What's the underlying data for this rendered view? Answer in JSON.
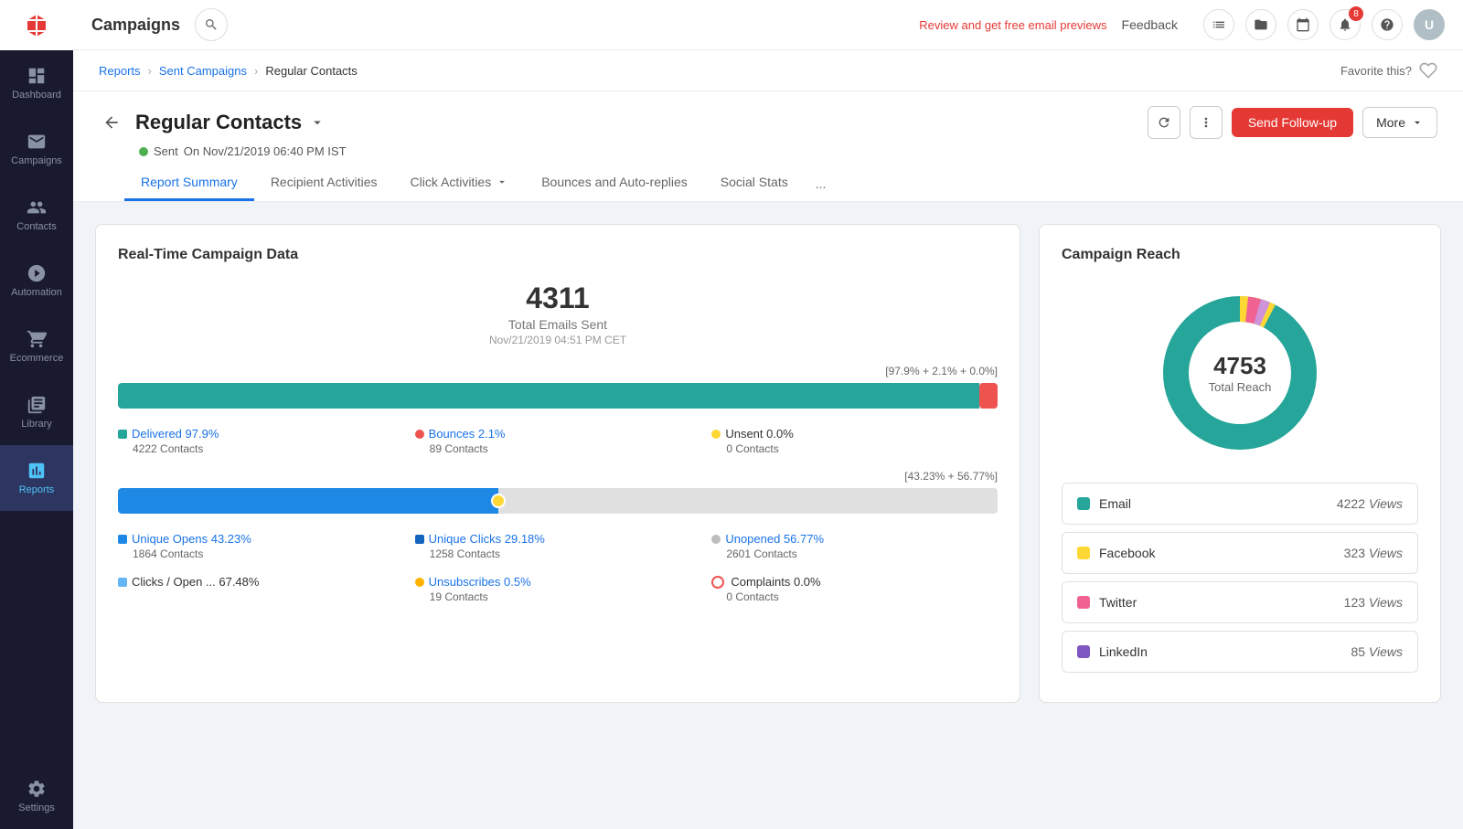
{
  "app": {
    "title": "Campaigns",
    "promo_text": "Review and get free email previews",
    "feedback_label": "Feedback"
  },
  "topbar_icons": {
    "notifications_badge": "8"
  },
  "breadcrumb": {
    "items": [
      "Reports",
      "Sent Campaigns",
      "Regular Contacts"
    ]
  },
  "favorite": {
    "label": "Favorite this?"
  },
  "page": {
    "title": "Regular Contacts",
    "sent_label": "Sent",
    "sent_date": "On Nov/21/2019 06:40 PM IST"
  },
  "buttons": {
    "send_followup": "Send Follow-up",
    "more": "More",
    "refresh": "↻",
    "settings": "⚙"
  },
  "tabs": {
    "items": [
      {
        "label": "Report Summary",
        "active": true
      },
      {
        "label": "Recipient Activities",
        "active": false
      },
      {
        "label": "Click Activities",
        "active": false,
        "has_chevron": true
      },
      {
        "label": "Bounces and Auto-replies",
        "active": false
      },
      {
        "label": "Social Stats",
        "active": false
      }
    ],
    "more_icon": "..."
  },
  "realtime": {
    "section_title": "Real-Time Campaign Data",
    "total_emails": "4311",
    "total_emails_label": "Total Emails Sent",
    "timestamp": "Nov/21/2019 04:51 PM CET",
    "progress1_label": "[97.9% + 2.1% + 0.0%]",
    "progress1_delivered_pct": 97.9,
    "progress1_bounced_pct": 2.1,
    "progress2_label": "[43.23% + 56.77%]",
    "progress2_opens_pct": 43.23,
    "stats": [
      {
        "dot": "green",
        "label": "Delivered",
        "pct": "97.9%",
        "value": "4222 Contacts",
        "link": true
      },
      {
        "dot": "orange",
        "label": "Bounces",
        "pct": "2.1%",
        "value": "89 Contacts",
        "link": true
      },
      {
        "dot": "yellow",
        "label": "Unsent",
        "pct": "0.0%",
        "value": "0 Contacts",
        "link": false
      },
      {
        "dot": "blue",
        "label": "Unique Opens",
        "pct": "43.23%",
        "value": "1864 Contacts",
        "link": true
      },
      {
        "dot": "darkblue",
        "label": "Unique Clicks",
        "pct": "29.18%",
        "value": "1258 Contacts",
        "link": true
      },
      {
        "dot": "gray",
        "label": "Unopened",
        "pct": "56.77%",
        "value": "2601 Contacts",
        "link": true
      },
      {
        "dot": "lightblue",
        "label": "Clicks / Open ...",
        "pct": "67.48%",
        "value": "",
        "link": false
      },
      {
        "dot": "amber",
        "label": "Unsubscribes",
        "pct": "0.5%",
        "value": "19 Contacts",
        "link": true
      },
      {
        "dot": "badge",
        "label": "Complaints",
        "pct": "0.0%",
        "value": "0 Contacts",
        "link": false
      }
    ]
  },
  "reach": {
    "section_title": "Campaign Reach",
    "total": "4753",
    "total_label": "Total Reach",
    "items": [
      {
        "name": "Email",
        "color": "#26a69a",
        "views": "4222",
        "views_label": "Views"
      },
      {
        "name": "Facebook",
        "color": "#fdd835",
        "views": "323",
        "views_label": "Views"
      },
      {
        "name": "Twitter",
        "color": "#f06292",
        "views": "123",
        "views_label": "Views"
      },
      {
        "name": "LinkedIn",
        "color": "#7e57c2",
        "views": "85",
        "views_label": "Views"
      }
    ],
    "donut": {
      "segments": [
        {
          "value": 4222,
          "color": "#26a69a"
        },
        {
          "value": 323,
          "color": "#fdd835"
        },
        {
          "value": 123,
          "color": "#f06292"
        },
        {
          "value": 85,
          "color": "#ce93d8"
        }
      ]
    }
  },
  "sidebar": {
    "items": [
      {
        "label": "Dashboard",
        "icon": "dashboard"
      },
      {
        "label": "Campaigns",
        "icon": "campaigns"
      },
      {
        "label": "Contacts",
        "icon": "contacts"
      },
      {
        "label": "Automation",
        "icon": "automation"
      },
      {
        "label": "Ecommerce",
        "icon": "ecommerce"
      },
      {
        "label": "Library",
        "icon": "library"
      },
      {
        "label": "Reports",
        "icon": "reports",
        "active": true
      }
    ],
    "bottom_items": [
      {
        "label": "Settings",
        "icon": "settings"
      }
    ]
  }
}
